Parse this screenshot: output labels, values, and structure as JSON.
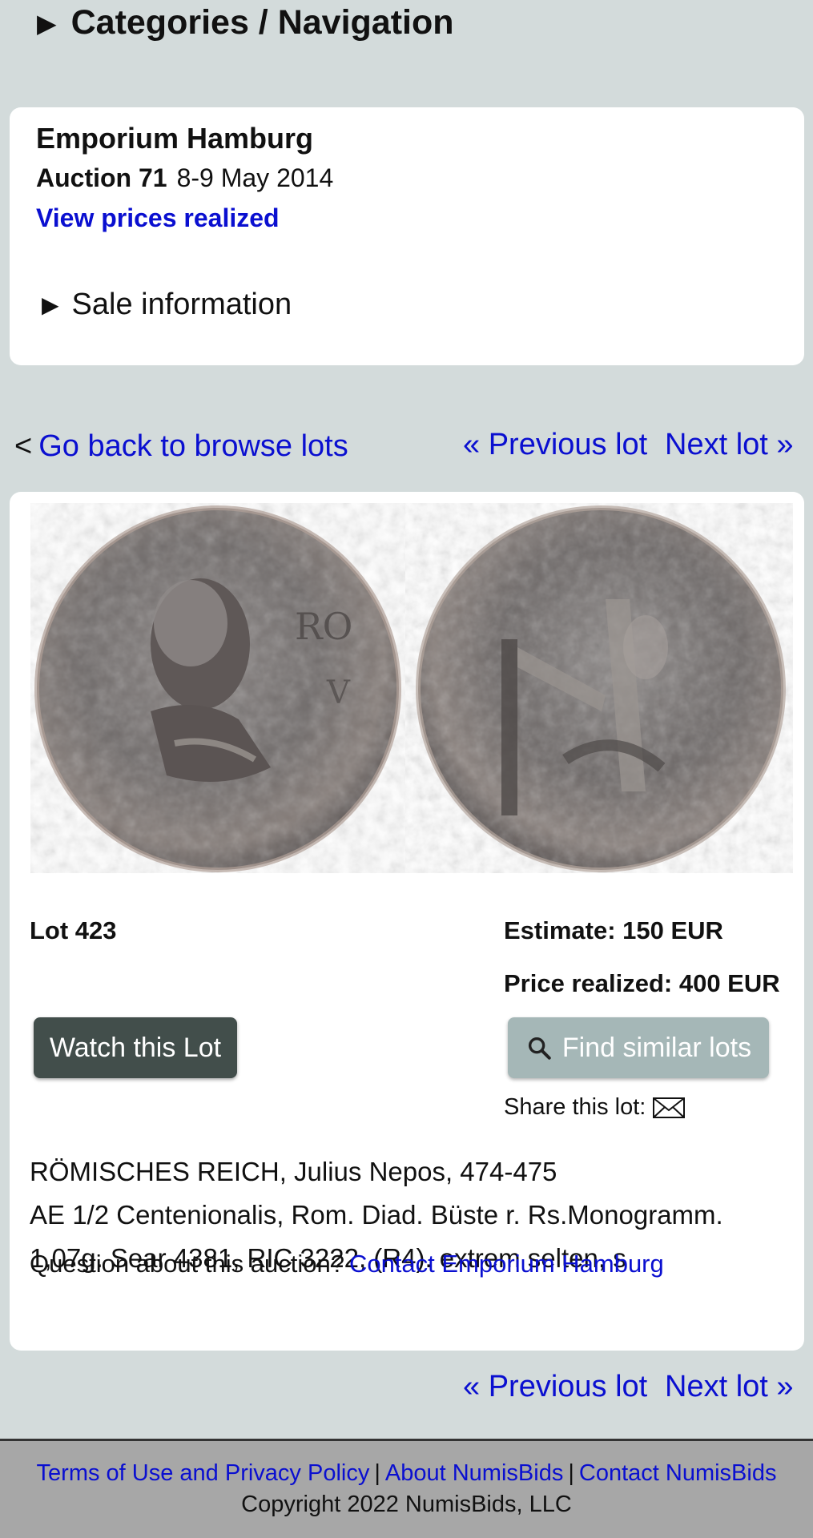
{
  "nav": {
    "categories_label": "Categories / Navigation"
  },
  "auction_info": {
    "house": "Emporium Hamburg",
    "auction_label": "Auction 71",
    "auction_date": "8-9 May 2014",
    "prices_link": "View prices realized",
    "sale_info_label": "Sale information"
  },
  "browse": {
    "back_prefix": "<",
    "back_link": "Go back to browse lots",
    "prev_link": "« Previous lot",
    "next_link": "Next lot »"
  },
  "lot": {
    "number": "Lot 423",
    "estimate": "Estimate: 150 EUR",
    "realized": "Price realized: 400 EUR",
    "watch_button": "Watch this Lot",
    "similar_button": "Find similar lots",
    "share_label": "Share this lot:",
    "description_lines": [
      "RÖMISCHES REICH, Julius Nepos, 474-475",
      "AE 1/2 Centenionalis, Rom. Diad. Büste r. Rs.Monogramm.",
      "1,07g. Sear 4381, RIC 3222, (R4). extrem selten, s"
    ],
    "question_prefix": "Question about this auction?",
    "contact_link": "Contact Emporium Hamburg"
  },
  "footer": {
    "terms_link": "Terms of Use and Privacy Policy",
    "about_link": "About NumisBids",
    "contact_link": "Contact NumisBids",
    "separator": "|",
    "copyright": "Copyright 2022 NumisBids, LLC"
  },
  "icons": {
    "triangle": "black-right-pointing-triangle",
    "search": "magnifier-icon",
    "mail": "envelope-icon"
  },
  "colors": {
    "background": "#d3dbdb",
    "link": "#0a0fd0",
    "watch_button": "#424e4b",
    "similar_button": "#a5b7b7",
    "footer": "#a7a7a7"
  }
}
